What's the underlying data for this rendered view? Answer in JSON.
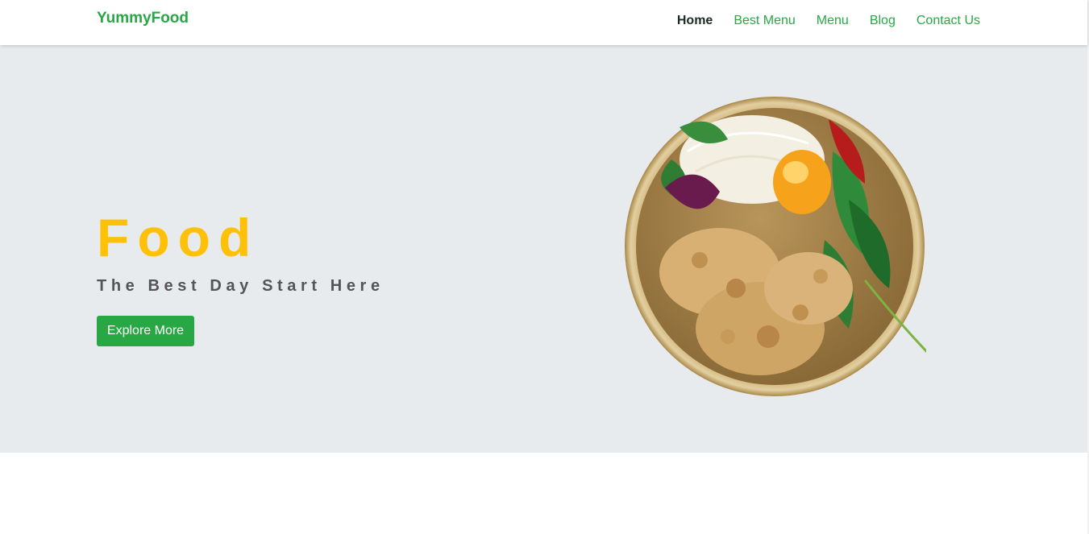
{
  "navbar": {
    "brand": "YummyFood",
    "links": [
      {
        "label": "Home",
        "active": true
      },
      {
        "label": "Best Menu",
        "active": false
      },
      {
        "label": "Menu",
        "active": false
      },
      {
        "label": "Blog",
        "active": false
      },
      {
        "label": "Contact Us",
        "active": false
      }
    ]
  },
  "hero": {
    "title": "Food",
    "subtitle": "The Best Day Start Here",
    "button_label": "Explore More",
    "image_icon": "food-bowl-icon"
  },
  "colors": {
    "brand_green": "#28a745",
    "title_yellow": "#ffc107",
    "hero_bg": "#e8ebee",
    "subtitle_gray": "#555555"
  }
}
